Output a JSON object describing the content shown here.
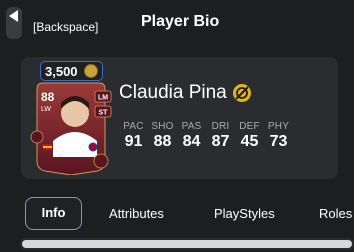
{
  "header": {
    "back_label": "[Backspace]",
    "title": "Player Bio"
  },
  "player": {
    "price": "3,500",
    "name": "Claudia Pina",
    "rating": "88",
    "position": "LW",
    "alt_positions": [
      "LM",
      "ST"
    ],
    "stats": [
      {
        "label": "PAC",
        "value": "91"
      },
      {
        "label": "SHO",
        "value": "88"
      },
      {
        "label": "PAS",
        "value": "84"
      },
      {
        "label": "DRI",
        "value": "87"
      },
      {
        "label": "DEF",
        "value": "45"
      },
      {
        "label": "PHY",
        "value": "73"
      }
    ]
  },
  "tabs": [
    {
      "label": "Info",
      "active": true
    },
    {
      "label": "Attributes",
      "active": false
    },
    {
      "label": "PlayStyles",
      "active": false
    },
    {
      "label": "Roles",
      "active": false
    }
  ],
  "colors": {
    "accent_blue": "#3e6bc8",
    "active_tab_border": "#6aa0c9",
    "card_red": "#7a1f2a",
    "badge_yellow": "#e0b51a"
  }
}
